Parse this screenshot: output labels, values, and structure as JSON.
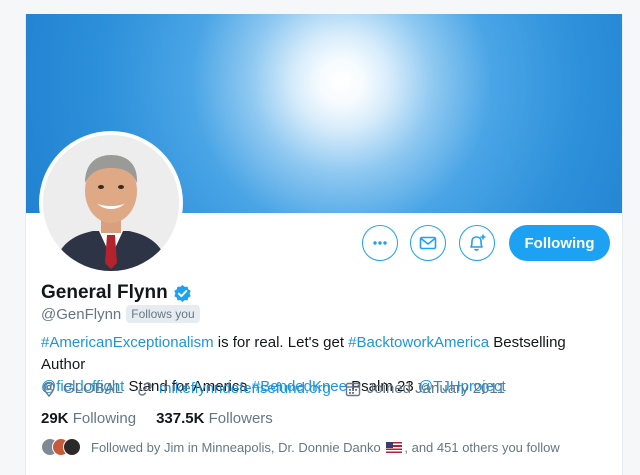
{
  "profile": {
    "name": "General Flynn",
    "handle": "@GenFlynn",
    "follows_you": "Follows you",
    "bio": [
      {
        "text": "#AmericanExceptionalism",
        "link": true
      },
      {
        "text": " is for real. Let's get ",
        "link": false
      },
      {
        "text": "#BacktoworkAmerica",
        "link": true
      },
      {
        "text": " Bestselling Author ",
        "link": false
      },
      {
        "text": "@fieldoffight",
        "link": true
      },
      {
        "text": " Stand for America ",
        "link": false
      },
      {
        "text": "#BendedKnee",
        "link": true
      },
      {
        "text": " Psalm 23 ",
        "link": false
      },
      {
        "text": "@TJHproject",
        "link": true
      }
    ],
    "location": "GLOBAL",
    "website": "mikeflynndefensefund.org",
    "joined": "Joined January 2011"
  },
  "stats": {
    "following_count": "29K",
    "following_label": "Following",
    "followers_count": "337.5K",
    "followers_label": "Followers"
  },
  "followed_by": {
    "text_before": "Followed by Jim in Minneapolis, Dr. Donnie Danko",
    "text_after": ", and 451 others you follow"
  },
  "actions": {
    "more_icon": "more-icon",
    "message_icon": "envelope-icon",
    "notify_icon": "bell-plus-icon",
    "following_label": "Following"
  },
  "colors": {
    "accent": "#1da1f2",
    "link": "#1b95e0",
    "secondary_text": "#657786"
  }
}
